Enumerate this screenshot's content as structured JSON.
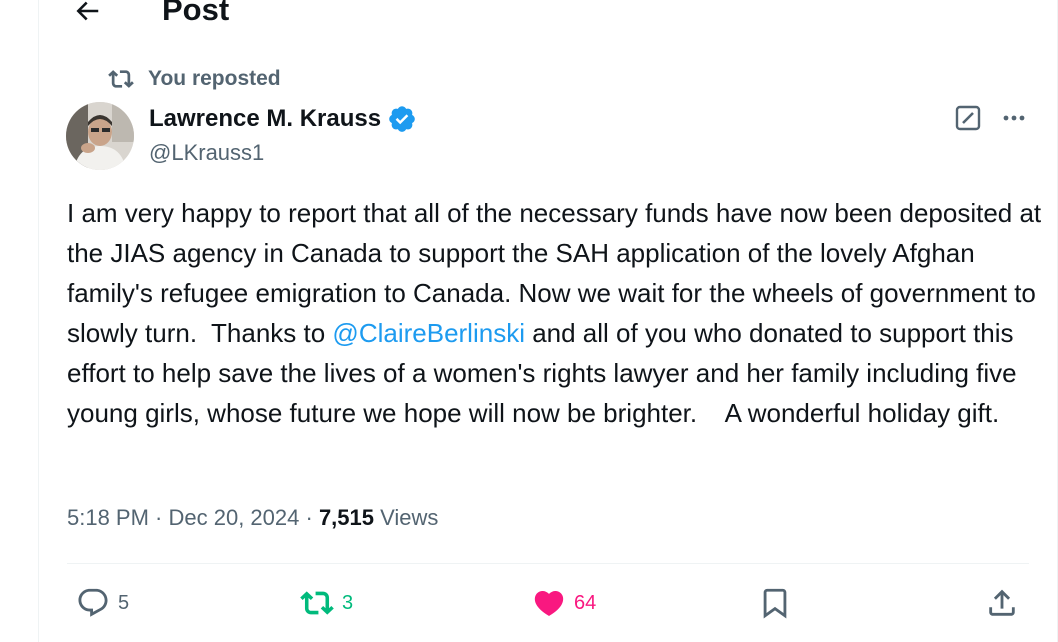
{
  "header": {
    "title": "Post"
  },
  "repost": {
    "label": "You reposted"
  },
  "author": {
    "name": "Lawrence M. Krauss",
    "handle": "@LKrauss1",
    "verified": true
  },
  "post": {
    "text_before_mention": "I am very happy to report that all of the necessary funds have now been deposited at the JIAS agency in Canada to support the SAH application of the lovely Afghan family's refugee emigration to Canada. Now we wait for the wheels of government to slowly turn.  Thanks to ",
    "mention": "@ClaireBerlinski",
    "text_after_mention": " and all of you who donated to support this effort to help save the lives of a women's rights lawyer and her family including five young girls, whose future we hope will now be brighter.    A wonderful holiday gift."
  },
  "meta": {
    "time": "5:18 PM",
    "sep1": " · ",
    "date": "Dec 20, 2024",
    "sep2": " · ",
    "views_count": "7,515",
    "views_label": " Views"
  },
  "actions": {
    "replies": "5",
    "reposts": "3",
    "likes": "64"
  },
  "colors": {
    "accent": "#1d9bf0",
    "repost_active": "#00ba7c",
    "like_active": "#f91880",
    "muted": "#536471",
    "text": "#0f1419"
  },
  "icons": {
    "back": "arrow-left-icon",
    "repost": "repost-icon",
    "verified": "verified-badge-icon",
    "grok": "grok-icon",
    "more": "more-horizontal-icon",
    "reply": "reply-icon",
    "like": "heart-icon",
    "bookmark": "bookmark-icon",
    "share": "share-icon"
  }
}
